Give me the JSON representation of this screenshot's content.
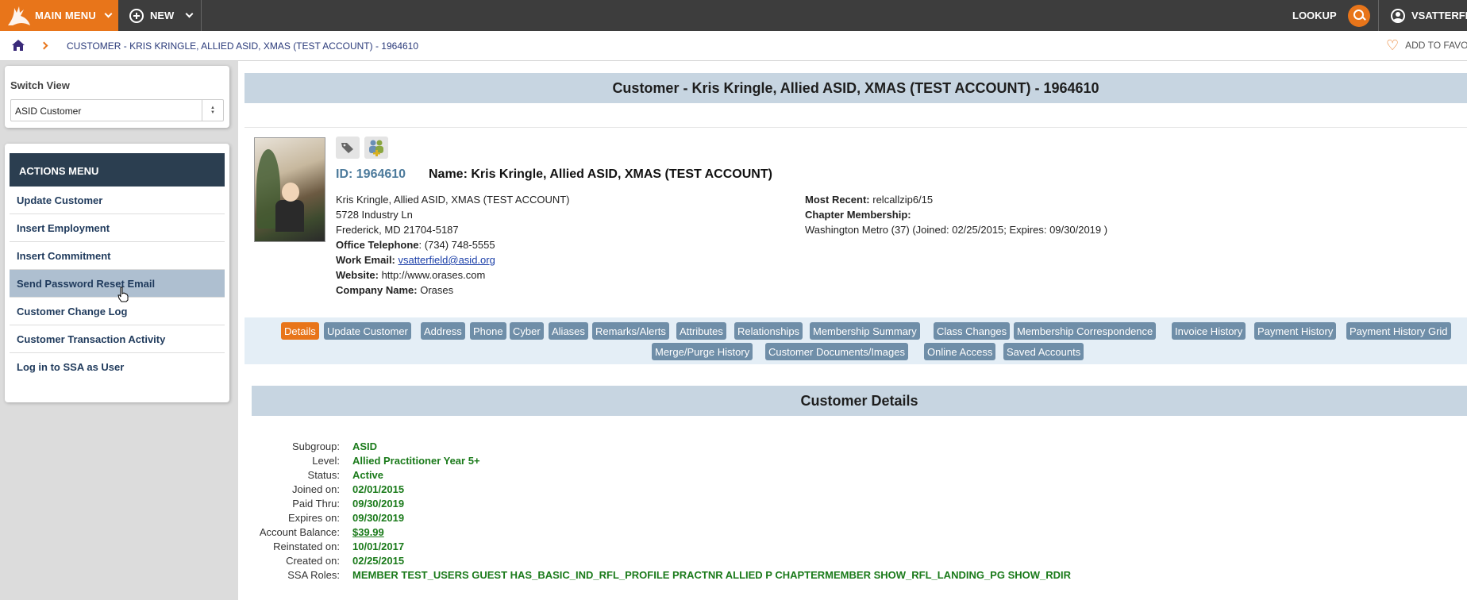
{
  "topbar": {
    "main_menu": "MAIN MENU",
    "new": "NEW",
    "lookup": "LOOKUP",
    "user": "VSATTERFI"
  },
  "breadcrumb": {
    "current": "CUSTOMER - KRIS KRINGLE, ALLIED ASID, XMAS (TEST ACCOUNT) - 1964610",
    "favorites": "ADD TO FAVO"
  },
  "sidebar": {
    "switch_view_title": "Switch View",
    "switch_view_value": "ASID Customer",
    "actions_title": "ACTIONS MENU",
    "actions": [
      "Update Customer",
      "Insert Employment",
      "Insert Commitment",
      "Send Password Reset Email",
      "Customer Change Log",
      "Customer Transaction Activity",
      "Log in to SSA as User"
    ]
  },
  "main": {
    "title": "Customer - Kris Kringle, Allied ASID, XMAS (TEST ACCOUNT) - 1964610",
    "profile": {
      "id": "ID: 1964610",
      "name": "Name: Kris Kringle, Allied ASID, XMAS (TEST ACCOUNT)",
      "address1": "Kris Kringle, Allied ASID, XMAS (TEST ACCOUNT)",
      "address2": "5728 Industry Ln",
      "address3": "Frederick, MD 21704-5187",
      "office_tel_label": "Office Telephone",
      "office_tel": ": (734) 748-5555",
      "work_email_label": "Work Email:",
      "work_email": "vsatterfield@asid.org",
      "website_label": "Website:",
      "website": "http://www.orases.com",
      "company_label": "Company Name:",
      "company": "Orases",
      "most_recent_label": "Most Recent:",
      "most_recent": "relcallzip6/15",
      "chapter_label": "Chapter Membership:",
      "chapter": "Washington Metro (37) (Joined: 02/25/2015; Expires: 09/30/2019 )"
    },
    "tabs_row1": [
      "Details",
      "Update Customer",
      "Address",
      "Phone",
      "Cyber",
      "Aliases",
      "Remarks/Alerts",
      "Attributes",
      "Relationships",
      "Membership Summary",
      "Class Changes",
      "Membership Correspondence",
      "Invoice History",
      "Payment History",
      "Payment History Grid"
    ],
    "tabs_row2": [
      "Merge/Purge History",
      "Customer Documents/Images",
      "Online Access",
      "Saved Accounts"
    ],
    "details_title": "Customer Details",
    "details": [
      {
        "label": "Subgroup:",
        "value": "ASID"
      },
      {
        "label": "Level:",
        "value": "Allied Practitioner Year 5+"
      },
      {
        "label": "Status:",
        "value": "Active"
      },
      {
        "label": "Joined on:",
        "value": "02/01/2015"
      },
      {
        "label": "Paid Thru:",
        "value": "09/30/2019"
      },
      {
        "label": "Expires on:",
        "value": "09/30/2019"
      },
      {
        "label": "Account Balance:",
        "value": "$39.99"
      },
      {
        "label": "Reinstated on:",
        "value": "10/01/2017"
      },
      {
        "label": "Created on:",
        "value": "02/25/2015"
      },
      {
        "label": "SSA Roles:",
        "value": "MEMBER TEST_USERS GUEST HAS_BASIC_IND_RFL_PROFILE PRACTNR ALLIED P CHAPTERMEMBER SHOW_RFL_LANDING_PG SHOW_RDIR"
      }
    ]
  },
  "colors": {
    "accent": "#e8751a",
    "topbar": "#3d3d3d",
    "header_navy": "#2b3e50",
    "tab": "#6f8ea8",
    "value_green": "#1a7a1a"
  }
}
